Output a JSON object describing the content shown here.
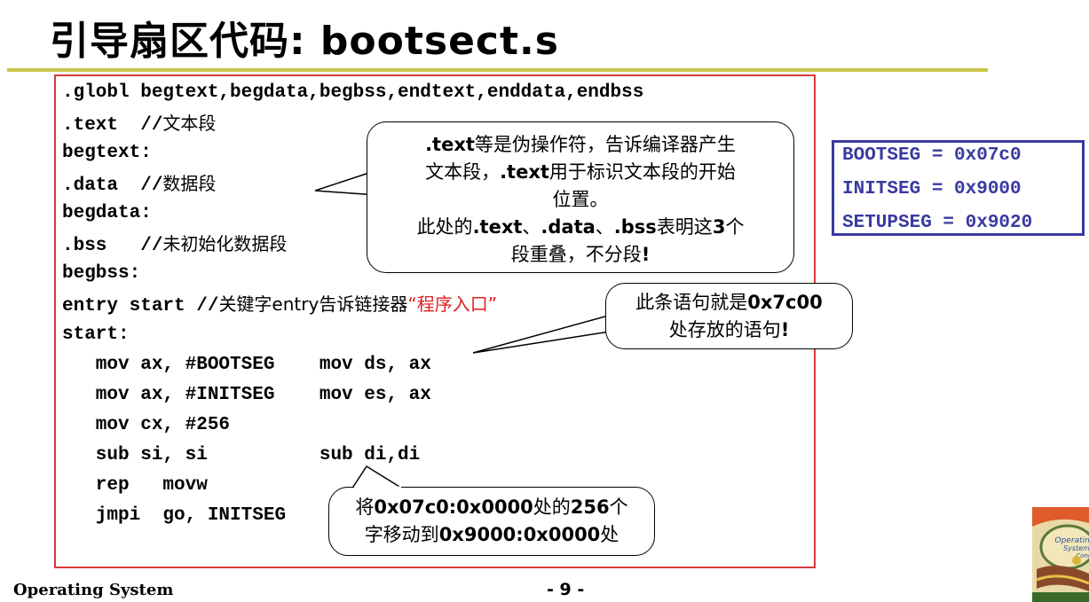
{
  "title": "引导扇区代码: bootsect.s",
  "code": [
    {
      "code": ".globl begtext,begdata,begbss,endtext,enddata,endbss",
      "comment": "",
      "highlight": ""
    },
    {
      "code": ".text  //",
      "comment": "文本段",
      "highlight": ""
    },
    {
      "code": "begtext:",
      "comment": "",
      "highlight": ""
    },
    {
      "code": ".data  //",
      "comment": "数据段",
      "highlight": ""
    },
    {
      "code": "begdata:",
      "comment": "",
      "highlight": ""
    },
    {
      "code": ".bss   //",
      "comment": "未初始化数据段",
      "highlight": ""
    },
    {
      "code": "begbss:",
      "comment": "",
      "highlight": ""
    },
    {
      "code": "entry start //",
      "comment": "关键字entry告诉链接器",
      "highlight": "“程序入口”"
    },
    {
      "code": "start:",
      "comment": "",
      "highlight": ""
    },
    {
      "code": "   mov ax, #BOOTSEG    mov ds, ax",
      "comment": "",
      "highlight": ""
    },
    {
      "code": "   mov ax, #INITSEG    mov es, ax",
      "comment": "",
      "highlight": ""
    },
    {
      "code": "   mov cx, #256",
      "comment": "",
      "highlight": ""
    },
    {
      "code": "   sub si, si          sub di,di",
      "comment": "",
      "highlight": ""
    },
    {
      "code": "   rep   movw",
      "comment": "",
      "highlight": ""
    },
    {
      "code": "   jmpi  go, INITSEG",
      "comment": "",
      "highlight": ""
    }
  ],
  "callouts": {
    "text_directive": {
      "l1a": ".text",
      "l1b": "等是伪操作符，告诉编译器产生",
      "l2a": "文本段，",
      "l2b": ".text",
      "l2c": "用于标识文本段的开始",
      "l3": "位置。",
      "l4a": "此处的",
      "l4b": ".text",
      "l4c": "、",
      "l4d": ".data",
      "l4e": "、",
      "l4f": ".bss",
      "l4g": "表明这",
      "l4h": "3",
      "l4i": "个",
      "l5a": "段重叠，不分段",
      "l5b": "!"
    },
    "entry": {
      "l1a": "此条语句就是",
      "l1b": "0x7c00",
      "l2a": "处存放的语句",
      "l2b": "!"
    },
    "move": {
      "l1a": "将",
      "l1b": "0x07c0:0x0000",
      "l1c": "处的",
      "l1d": "256",
      "l1e": "个",
      "l2a": "字移动到",
      "l2b": "0x9000:0x0000",
      "l2c": "处"
    }
  },
  "segments": [
    "BOOTSEG = 0x07c0",
    "INITSEG = 0x9000",
    "SETUPSEG = 0x9020"
  ],
  "footer": {
    "left": "Operating System",
    "page": "- 9 -"
  },
  "logo_text": "Operating Systems Concepts",
  "colors": {
    "title_rule": "#c8c44a",
    "code_border": "#d83a3a",
    "highlight_red": "#e02020",
    "segment_blue": "#3a3aa0"
  }
}
